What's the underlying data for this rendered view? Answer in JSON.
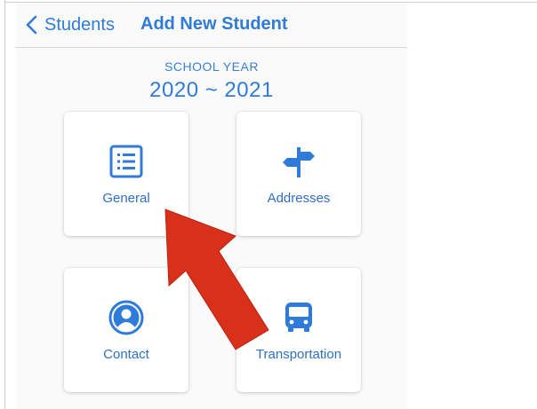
{
  "nav": {
    "back_label": "Students",
    "title": "Add New Student"
  },
  "school_year": {
    "label": "SCHOOL YEAR",
    "value": "2020 ~ 2021"
  },
  "tiles": [
    {
      "label": "General",
      "icon": "list-icon"
    },
    {
      "label": "Addresses",
      "icon": "signpost-icon"
    },
    {
      "label": "Contact",
      "icon": "person-icon"
    },
    {
      "label": "Transportation",
      "icon": "bus-icon"
    }
  ],
  "colors": {
    "accent": "#2f7bd9",
    "annotation_arrow": "#d9301c"
  }
}
